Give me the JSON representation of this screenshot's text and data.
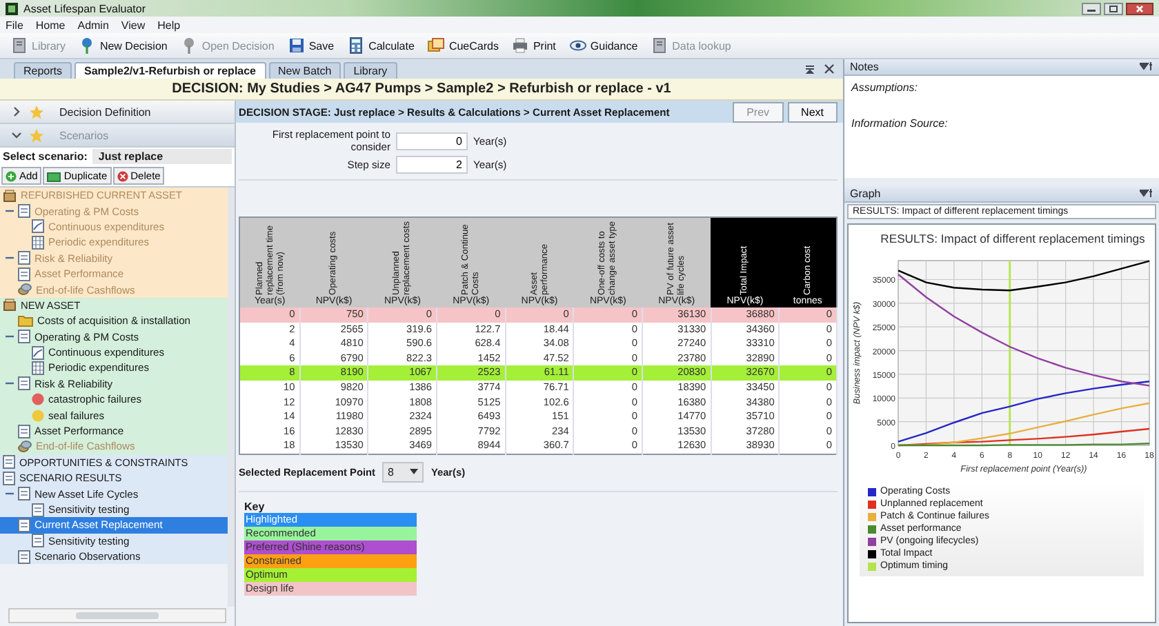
{
  "window": {
    "title": "Asset Lifespan Evaluator"
  },
  "menu": [
    "File",
    "Home",
    "Admin",
    "View",
    "Help"
  ],
  "toolbar": [
    {
      "label": "Library",
      "kind": "library",
      "disabled": true
    },
    {
      "label": "New Decision",
      "kind": "new",
      "disabled": false
    },
    {
      "label": "Open Decision",
      "kind": "open",
      "disabled": true
    },
    {
      "label": "Save",
      "kind": "save",
      "disabled": false
    },
    {
      "label": "Calculate",
      "kind": "calculate",
      "disabled": false
    },
    {
      "label": "CueCards",
      "kind": "cuecards",
      "disabled": false
    },
    {
      "label": "Print",
      "kind": "print",
      "disabled": false
    },
    {
      "label": "Guidance",
      "kind": "guidance",
      "disabled": false
    },
    {
      "label": "Data lookup",
      "kind": "lookup",
      "disabled": true
    }
  ],
  "doc_tabs": [
    {
      "label": "Reports",
      "selected": false
    },
    {
      "label": "Sample2/v1-Refurbish or replace",
      "selected": true
    },
    {
      "label": "New Batch",
      "selected": false
    },
    {
      "label": "Library",
      "selected": false
    }
  ],
  "decision_title": "DECISION: My Studies > AG47 Pumps > Sample2 > Refurbish or replace - v1",
  "sidebar": {
    "panels": [
      {
        "label": "Decision Definition",
        "expanded": false
      },
      {
        "label": "Scenarios",
        "expanded": true
      }
    ],
    "scenario_label": "Select scenario:",
    "scenario_value": "Just replace",
    "actions": [
      {
        "label": "Add",
        "kind": "add"
      },
      {
        "label": "Duplicate",
        "kind": "duplicate"
      },
      {
        "label": "Delete",
        "kind": "delete"
      }
    ],
    "tree": [
      {
        "label": "REFURBISHED CURRENT ASSET",
        "kind": "asset",
        "color": "#fce8c8",
        "selected": false,
        "disabled": true,
        "children": [
          {
            "label": "Operating & PM Costs",
            "kind": "page",
            "expanded": true,
            "selected": false,
            "disabled": true,
            "children": [
              {
                "label": "Continuous expenditures",
                "kind": "chart",
                "selected": false,
                "disabled": true
              },
              {
                "label": "Periodic expenditures",
                "kind": "grid",
                "selected": false,
                "disabled": true
              }
            ]
          },
          {
            "label": "Risk & Reliability",
            "kind": "page",
            "expanded": true,
            "selected": false,
            "disabled": true
          },
          {
            "label": "Asset Performance",
            "kind": "page",
            "selected": false,
            "disabled": true
          },
          {
            "label": "End-of-life Cashflows",
            "kind": "coins",
            "selected": false,
            "disabled": true
          }
        ]
      },
      {
        "label": "NEW ASSET",
        "kind": "asset",
        "color": "#d4efdb",
        "selected": false,
        "disabled": false,
        "children": [
          {
            "label": "Costs of acquisition & installation",
            "kind": "folder",
            "selected": false,
            "disabled": false
          },
          {
            "label": "Operating & PM Costs",
            "kind": "page",
            "expanded": true,
            "selected": false,
            "disabled": false,
            "children": [
              {
                "label": "Continuous expenditures",
                "kind": "chart",
                "selected": false,
                "disabled": false
              },
              {
                "label": "Periodic expenditures",
                "kind": "grid",
                "selected": false,
                "disabled": false
              }
            ]
          },
          {
            "label": "Risk & Reliability",
            "kind": "page",
            "expanded": true,
            "selected": false,
            "disabled": false,
            "children": [
              {
                "label": "catastrophic failures",
                "kind": "failure",
                "color": "#e06060",
                "selected": false,
                "disabled": false
              },
              {
                "label": "seal failures",
                "kind": "failure",
                "color": "#f0c840",
                "selected": false,
                "disabled": false
              }
            ]
          },
          {
            "label": "Asset Performance",
            "kind": "page",
            "selected": false,
            "disabled": false
          },
          {
            "label": "End-of-life Cashflows",
            "kind": "coins",
            "selected": false,
            "disabled": true
          }
        ]
      },
      {
        "label": "OPPORTUNITIES & CONSTRAINTS",
        "kind": "page",
        "color": "#dce8f6",
        "selected": false,
        "disabled": false
      },
      {
        "label": "SCENARIO RESULTS",
        "kind": "page",
        "color": "#dce8f6",
        "selected": false,
        "disabled": false,
        "children": [
          {
            "label": "New Asset Life Cycles",
            "kind": "page",
            "expanded": true,
            "selected": false,
            "disabled": false,
            "children": [
              {
                "label": "Sensitivity testing",
                "kind": "page",
                "selected": false,
                "disabled": false
              }
            ]
          },
          {
            "label": "Current Asset Replacement",
            "kind": "page",
            "selected": true,
            "disabled": false,
            "children": [
              {
                "label": "Sensitivity testing",
                "kind": "page",
                "selected": false,
                "disabled": false
              }
            ]
          },
          {
            "label": "Scenario Observations",
            "kind": "page",
            "selected": false,
            "disabled": false
          }
        ]
      }
    ]
  },
  "stage": {
    "text": "DECISION STAGE: Just replace > Results & Calculations > Current Asset Replacement",
    "buttons": [
      {
        "label": "Prev",
        "disabled": true
      },
      {
        "label": "Next",
        "disabled": false
      }
    ]
  },
  "fields": [
    {
      "label": "First replacement point to consider",
      "value": "0",
      "unit": "Year(s)"
    },
    {
      "label": "Step size",
      "value": "2",
      "unit": "Year(s)"
    }
  ],
  "table": {
    "columns": [
      {
        "heading": "Planned replacement time (from now)",
        "unit": "Year(s)",
        "dark": false
      },
      {
        "heading": "Operating costs",
        "unit": "NPV(k$)",
        "dark": false
      },
      {
        "heading": "Unplanned replacement costs",
        "unit": "NPV(k$)",
        "dark": false
      },
      {
        "heading": "Patch & Continue Costs",
        "unit": "NPV(k$)",
        "dark": false
      },
      {
        "heading": "Asset performance",
        "unit": "NPV(k$)",
        "dark": false
      },
      {
        "heading": "One-off costs to change asset type",
        "unit": "NPV(k$)",
        "dark": false
      },
      {
        "heading": "PV of future asset life cycles",
        "unit": "NPV(k$)",
        "dark": false
      },
      {
        "heading": "Total Impact",
        "unit": "NPV(k$)",
        "dark": true
      },
      {
        "heading": "Carbon cost",
        "unit": "tonnes",
        "dark": true
      }
    ],
    "rows": [
      {
        "cells": [
          "0",
          "750",
          "0",
          "0",
          "0",
          "0",
          "36130",
          "36880",
          "0"
        ],
        "color": "#f6c4c6"
      },
      {
        "cells": [
          "2",
          "2565",
          "319.6",
          "122.7",
          "18.44",
          "0",
          "31330",
          "34360",
          "0"
        ]
      },
      {
        "cells": [
          "4",
          "4810",
          "590.6",
          "628.4",
          "34.08",
          "0",
          "27240",
          "33310",
          "0"
        ]
      },
      {
        "cells": [
          "6",
          "6790",
          "822.3",
          "1452",
          "47.52",
          "0",
          "23780",
          "32890",
          "0"
        ]
      },
      {
        "cells": [
          "8",
          "8190",
          "1067",
          "2523",
          "61.11",
          "0",
          "20830",
          "32670",
          "0"
        ],
        "color": "#a4ef38"
      },
      {
        "cells": [
          "10",
          "9820",
          "1386",
          "3774",
          "76.71",
          "0",
          "18390",
          "33450",
          "0"
        ]
      },
      {
        "cells": [
          "12",
          "10970",
          "1808",
          "5125",
          "102.6",
          "0",
          "16380",
          "34380",
          "0"
        ]
      },
      {
        "cells": [
          "14",
          "11980",
          "2324",
          "6493",
          "151",
          "0",
          "14770",
          "35710",
          "0"
        ]
      },
      {
        "cells": [
          "16",
          "12830",
          "2895",
          "7792",
          "234",
          "0",
          "13530",
          "37280",
          "0"
        ]
      },
      {
        "cells": [
          "18",
          "13530",
          "3469",
          "8944",
          "360.7",
          "0",
          "12630",
          "38930",
          "0"
        ]
      }
    ]
  },
  "selected_point": {
    "label": "Selected Replacement Point",
    "value": "8",
    "unit": "Year(s)"
  },
  "key": {
    "title": "Key",
    "items": [
      {
        "label": "Highlighted",
        "color": "#2a8ef2"
      },
      {
        "label": "Recommended",
        "color": "#98f49c"
      },
      {
        "label": "Preferred (Shine reasons)",
        "color": "#b04ed0"
      },
      {
        "label": "Constrained",
        "color": "#ffa012"
      },
      {
        "label": "Optimum",
        "color": "#a6f034"
      },
      {
        "label": "Design life",
        "color": "#f2c4c8"
      }
    ]
  },
  "notes": {
    "title": "Notes",
    "lines": [
      "Assumptions:",
      "Information Source:"
    ]
  },
  "graph": {
    "title": "Graph",
    "subtitle": "RESULTS: Impact of different replacement timings",
    "chart_data": {
      "type": "line",
      "title": "RESULTS: Impact of different replacement timings",
      "xlabel": "First replacement point (Year(s))",
      "ylabel": "Business impact (NPV k$)",
      "x": [
        0,
        2,
        4,
        6,
        8,
        10,
        12,
        14,
        16,
        18
      ],
      "series": [
        {
          "name": "Operating Costs",
          "color": "#2626c8",
          "values": [
            800,
            2600,
            4800,
            6800,
            8200,
            9800,
            11000,
            12000,
            12800,
            13500
          ]
        },
        {
          "name": "Unplanned replacement",
          "color": "#e03020",
          "values": [
            0,
            300,
            600,
            800,
            1100,
            1400,
            1800,
            2300,
            2900,
            3500
          ]
        },
        {
          "name": "Patch & Continue failures",
          "color": "#e8b040",
          "values": [
            0,
            100,
            600,
            1500,
            2500,
            3800,
            5100,
            6500,
            7800,
            8900
          ]
        },
        {
          "name": "Asset performance",
          "color": "#4a8a30",
          "values": [
            0,
            0,
            0,
            0,
            100,
            100,
            100,
            200,
            200,
            400
          ]
        },
        {
          "name": "PV (ongoing lifecycles)",
          "color": "#9040a0",
          "values": [
            36100,
            31300,
            27200,
            23800,
            20800,
            18400,
            16400,
            14800,
            13500,
            12600
          ]
        },
        {
          "name": "Total Impact",
          "color": "#000000",
          "values": [
            36900,
            34400,
            33300,
            32900,
            32700,
            33500,
            34400,
            35700,
            37300,
            38900
          ]
        }
      ],
      "grid": true,
      "legend": "bottom",
      "xlim": [
        0,
        18
      ],
      "ylim": [
        0,
        39000
      ],
      "xticks": [
        0,
        2,
        4,
        6,
        8,
        10,
        12,
        14,
        16,
        18
      ],
      "yticks": [
        0,
        5000,
        10000,
        15000,
        20000,
        25000,
        30000,
        35000
      ],
      "ref_lines": [
        {
          "axis": "x",
          "value": 8,
          "label": "Optimum timing",
          "color": "#b4e44c"
        }
      ]
    }
  }
}
